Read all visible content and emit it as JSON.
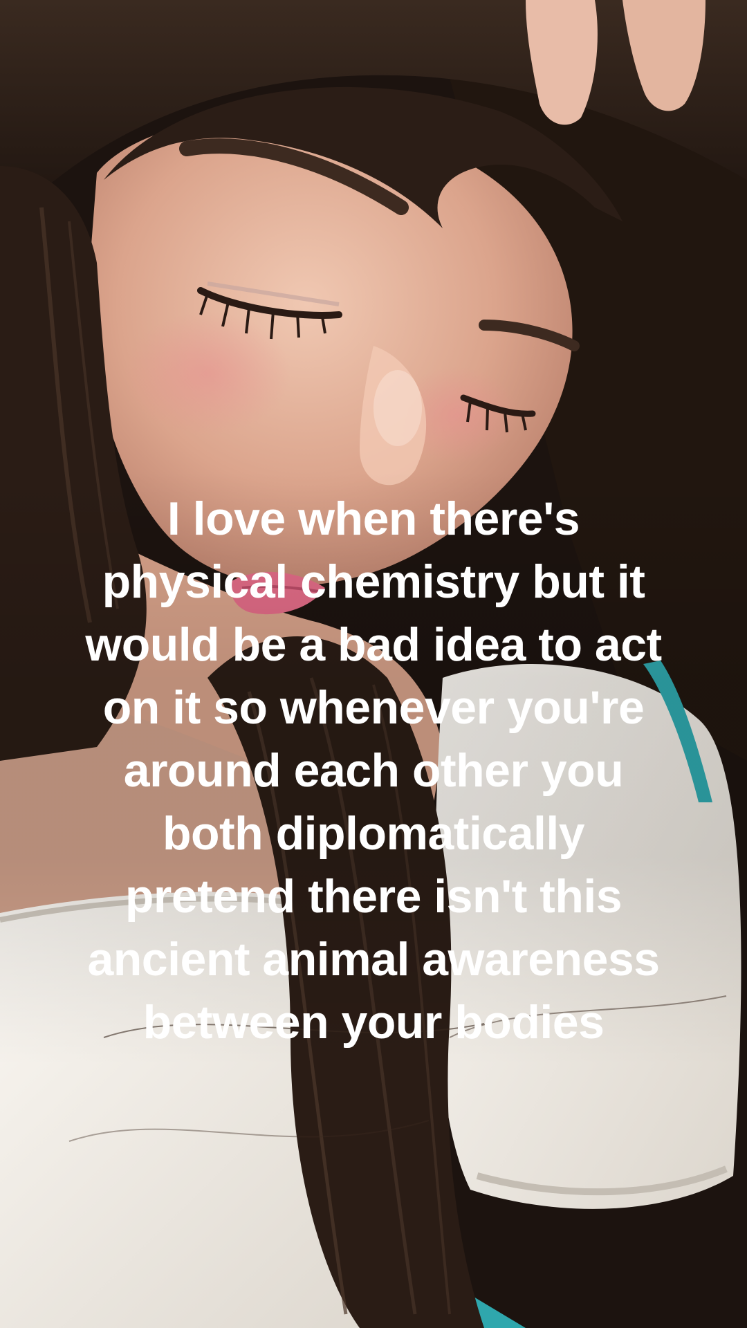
{
  "caption": {
    "lines": [
      "I love when there's",
      "physical chemistry but it",
      "would be a bad idea to act",
      "on it so whenever you're",
      "around each other you",
      "both diplomatically",
      "pretend there isn't this",
      "ancient animal awareness",
      "between your bodies"
    ]
  },
  "photo": {
    "subject": "selfie of a woman with dark bangs looking down, off-shoulder white blouse",
    "colors": {
      "hair": "#2a1c15",
      "skin": "#e2b49c",
      "blouse": "#f3efe9",
      "lips": "#e06b86",
      "strap": "#2fa7ad",
      "caption_text": "#ffffff"
    }
  }
}
